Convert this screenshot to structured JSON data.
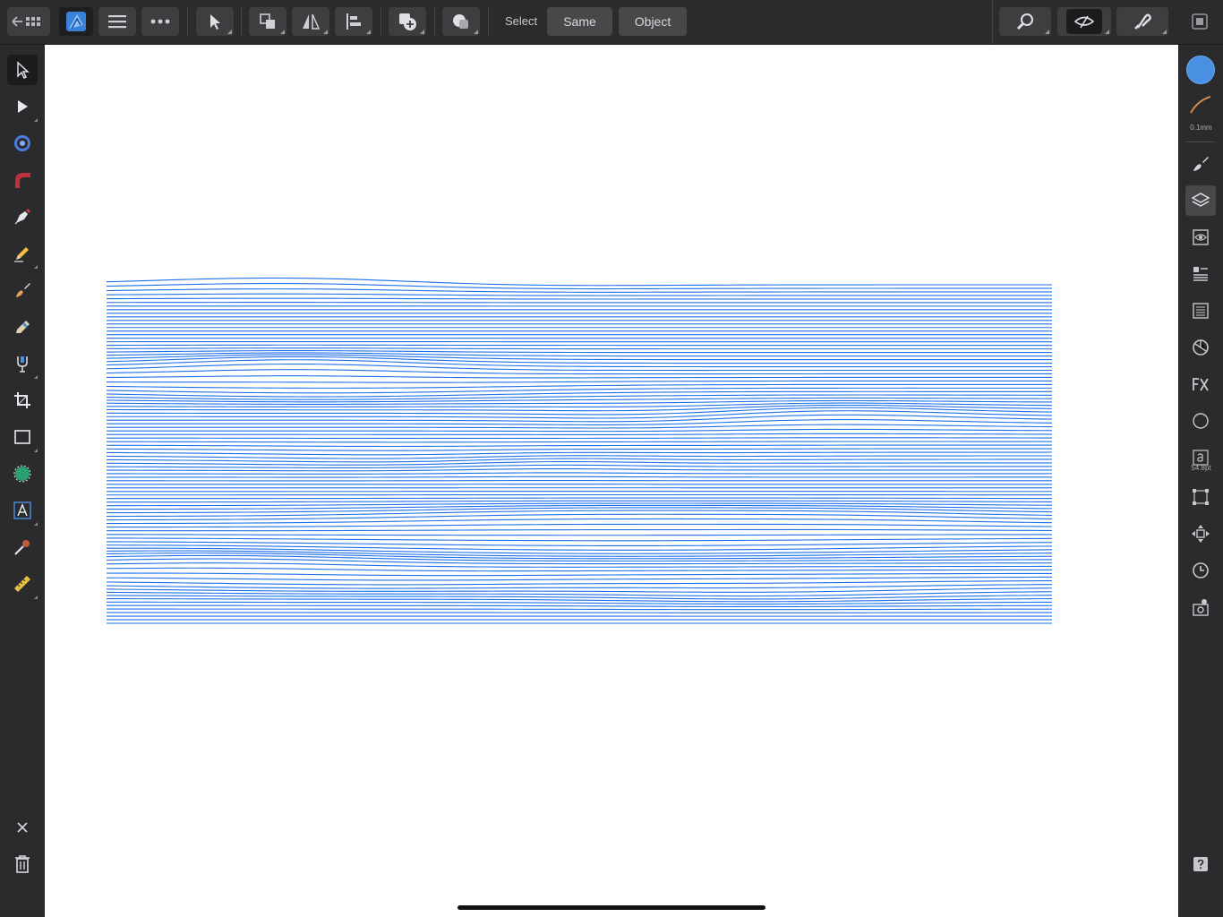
{
  "toolbar": {
    "select_label": "Select",
    "same_label": "Same",
    "object_label": "Object"
  },
  "studio": {
    "stroke_width": "0.1mm",
    "font_size": "54.8pt"
  },
  "colors": {
    "accent_fill": "#4a90e2",
    "line_color": "#1f6fe8",
    "stroke_color": "#d08a4a"
  },
  "icons": {
    "left_tools": [
      "move-tool-icon",
      "node-tool-icon",
      "corner-tool-icon",
      "pencil-stroke-icon",
      "pen-tool-icon",
      "pencil-tool-icon",
      "brush-icon",
      "fill-brush-icon",
      "vector-crop-icon",
      "crop-tool-icon",
      "rectangle-tool-icon",
      "shape-tool-icon",
      "text-tool-icon",
      "color-picker-icon",
      "measure-tool-icon"
    ],
    "studio": [
      "color-swatch-icon",
      "stroke-icon",
      "brushes-icon",
      "layers-icon",
      "appearance-icon",
      "text-styles-icon",
      "assets-icon",
      "stock-icon",
      "fx-icon",
      "navigator-icon",
      "character-icon",
      "transform-icon",
      "constraints-icon",
      "history-icon",
      "preferences-icon",
      "help-icon"
    ]
  }
}
